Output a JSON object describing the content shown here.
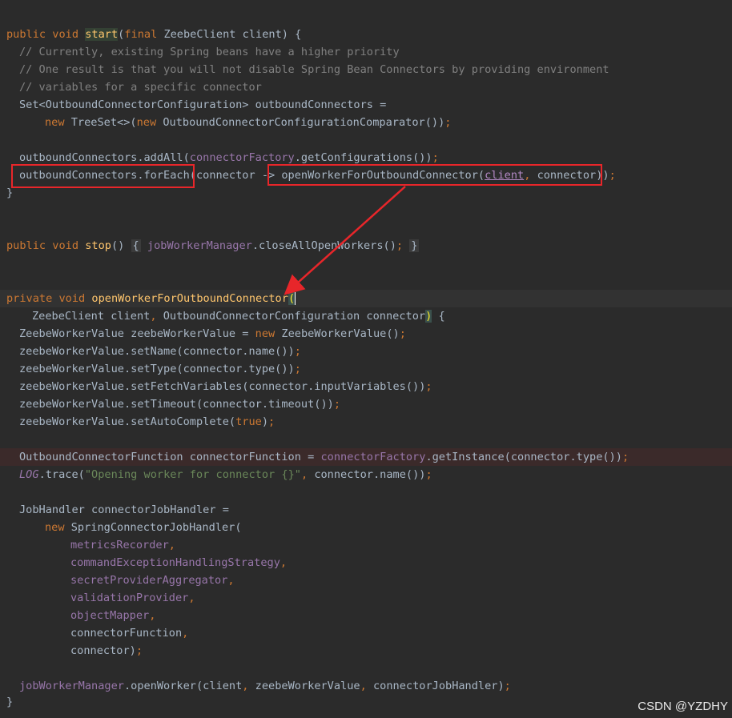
{
  "code": {
    "lines": [
      {
        "t": [
          [
            "kw",
            "public void "
          ],
          [
            "start",
            "start"
          ],
          [
            "plain",
            "("
          ],
          [
            "kw",
            "final "
          ],
          [
            "plain",
            "ZeebeClient client) {"
          ]
        ]
      },
      {
        "t": [
          [
            "cmt",
            "// Currently, existing Spring beans have a higher priority"
          ]
        ]
      },
      {
        "t": [
          [
            "cmt",
            "// One result is that you will not disable Spring Bean Connectors by providing environment"
          ]
        ]
      },
      {
        "t": [
          [
            "cmt",
            "// variables for a specific connector"
          ]
        ]
      },
      {
        "t": [
          [
            "plain",
            "Set<OutboundConnectorConfiguration> outboundConnectors ="
          ]
        ]
      },
      {
        "t": [
          [
            "kw",
            "new "
          ],
          [
            "plain",
            "TreeSet<>("
          ],
          [
            "kw",
            "new "
          ],
          [
            "plain",
            "OutboundConnectorConfigurationComparator())"
          ],
          [
            "kw",
            ";"
          ]
        ]
      },
      {
        "t": []
      },
      {
        "t": [
          [
            "plain",
            "outboundConnectors.addAll("
          ],
          [
            "fld",
            "connectorFactory"
          ],
          [
            "plain",
            ".getConfigurations())"
          ],
          [
            "kw",
            ";"
          ]
        ]
      },
      {
        "t": [
          [
            "plain",
            "outboundConnectors.forEach(connector -> openWorkerForOutboundConnector("
          ],
          [
            "ul",
            "client"
          ],
          [
            "kw",
            ", "
          ],
          [
            "plain",
            "connector))"
          ],
          [
            "kw",
            ";"
          ]
        ]
      },
      {
        "t": [
          [
            "plain",
            "}"
          ]
        ]
      },
      {
        "t": []
      },
      {
        "t": []
      },
      {
        "t": [
          [
            "kw",
            "public void "
          ],
          [
            "fn",
            "stop"
          ],
          [
            "plain",
            "() "
          ],
          [
            "fold",
            "{"
          ],
          [
            "plain",
            " "
          ],
          [
            "fld",
            "jobWorkerManager"
          ],
          [
            "plain",
            ".closeAllOpenWorkers()"
          ],
          [
            "kw",
            ";"
          ],
          [
            "plain",
            " "
          ],
          [
            "fold",
            "}"
          ]
        ]
      },
      {
        "t": []
      },
      {
        "t": []
      },
      {
        "t": [
          [
            "kw",
            "private void "
          ],
          [
            "fn",
            "openWorkerForOutboundConnector"
          ],
          [
            "br",
            "("
          ]
        ]
      },
      {
        "t": [
          [
            "plain",
            "ZeebeClient client"
          ],
          [
            "kw",
            ", "
          ],
          [
            "plain",
            "OutboundConnectorConfiguration connector"
          ],
          [
            "brc",
            ")"
          ],
          [
            "plain",
            " {"
          ]
        ]
      },
      {
        "t": [
          [
            "plain",
            "ZeebeWorkerValue zeebeWorkerValue = "
          ],
          [
            "kw",
            "new "
          ],
          [
            "plain",
            "ZeebeWorkerValue()"
          ],
          [
            "kw",
            ";"
          ]
        ]
      },
      {
        "t": [
          [
            "plain",
            "zeebeWorkerValue.setName(connector.name())"
          ],
          [
            "kw",
            ";"
          ]
        ]
      },
      {
        "t": [
          [
            "plain",
            "zeebeWorkerValue.setType(connector.type())"
          ],
          [
            "kw",
            ";"
          ]
        ]
      },
      {
        "t": [
          [
            "plain",
            "zeebeWorkerValue.setFetchVariables(connector.inputVariables())"
          ],
          [
            "kw",
            ";"
          ]
        ]
      },
      {
        "t": [
          [
            "plain",
            "zeebeWorkerValue.setTimeout(connector.timeout())"
          ],
          [
            "kw",
            ";"
          ]
        ]
      },
      {
        "t": [
          [
            "plain",
            "zeebeWorkerValue.setAutoComplete("
          ],
          [
            "kw",
            "true"
          ],
          [
            "plain",
            ")"
          ],
          [
            "kw",
            ";"
          ]
        ]
      },
      {
        "t": []
      },
      {
        "t": [
          [
            "plain",
            "OutboundConnectorFunction connectorFunction = "
          ],
          [
            "fld",
            "connectorFactory"
          ],
          [
            "plain",
            ".getInstance(connector.type())"
          ],
          [
            "kw",
            ";"
          ]
        ]
      },
      {
        "t": [
          [
            "st",
            "LOG"
          ],
          [
            "plain",
            ".trace("
          ],
          [
            "str",
            "\"Opening worker for connector {}\""
          ],
          [
            "kw",
            ", "
          ],
          [
            "plain",
            "connector.name())"
          ],
          [
            "kw",
            ";"
          ]
        ]
      },
      {
        "t": []
      },
      {
        "t": [
          [
            "plain",
            "JobHandler connectorJobHandler ="
          ]
        ]
      },
      {
        "t": [
          [
            "kw",
            "new "
          ],
          [
            "plain",
            "SpringConnectorJobHandler("
          ]
        ]
      },
      {
        "t": [
          [
            "fld",
            "metricsRecorder"
          ],
          [
            "kw",
            ","
          ]
        ]
      },
      {
        "t": [
          [
            "fld",
            "commandExceptionHandlingStrategy"
          ],
          [
            "kw",
            ","
          ]
        ]
      },
      {
        "t": [
          [
            "fld",
            "secretProviderAggregator"
          ],
          [
            "kw",
            ","
          ]
        ]
      },
      {
        "t": [
          [
            "fld",
            "validationProvider"
          ],
          [
            "kw",
            ","
          ]
        ]
      },
      {
        "t": [
          [
            "fld",
            "objectMapper"
          ],
          [
            "kw",
            ","
          ]
        ]
      },
      {
        "t": [
          [
            "plain",
            "connectorFunction"
          ],
          [
            "kw",
            ","
          ]
        ]
      },
      {
        "t": [
          [
            "plain",
            "connector)"
          ],
          [
            "kw",
            ";"
          ]
        ]
      },
      {
        "t": []
      },
      {
        "t": [
          [
            "fld",
            "jobWorkerManager"
          ],
          [
            "plain",
            ".openWorker(client"
          ],
          [
            "kw",
            ", "
          ],
          [
            "plain",
            "zeebeWorkerValue"
          ],
          [
            "kw",
            ", "
          ],
          [
            "plain",
            "connectorJobHandler)"
          ],
          [
            "kw",
            ";"
          ]
        ]
      },
      {
        "t": [
          [
            "plain",
            "}"
          ]
        ]
      }
    ]
  },
  "watermark": "CSDN @YZDHY",
  "colors": {
    "background": "#2b2b2b",
    "keyword": "#cc7832",
    "method": "#ffc66d",
    "field": "#9876aa",
    "string": "#6a8759",
    "comment": "#808080",
    "annotation_box": "#e8262a"
  }
}
